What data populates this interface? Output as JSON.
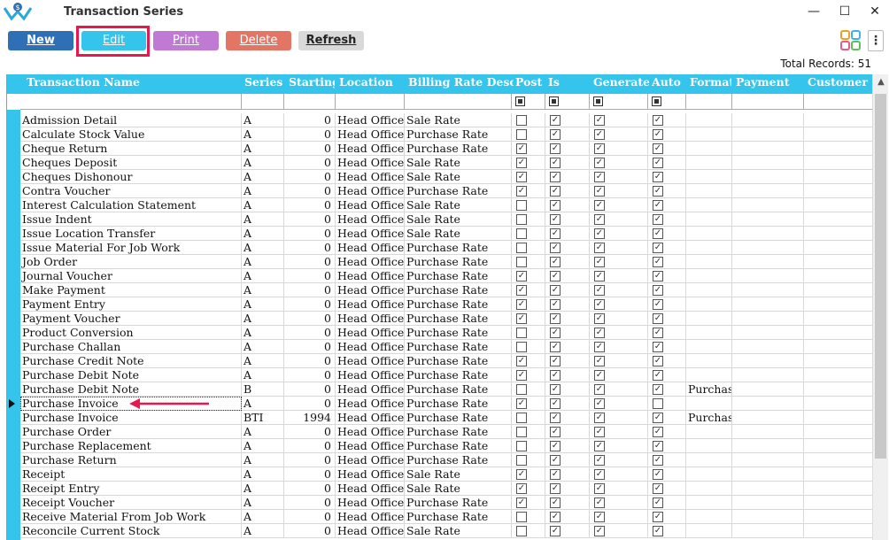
{
  "window": {
    "title": "Transaction Series",
    "minimize": "—",
    "maximize": "☐",
    "close": "✕"
  },
  "toolbar": {
    "new": "New",
    "edit": "Edit",
    "print": "Print",
    "delete": "Delete",
    "refresh": "Refresh",
    "menu": "⋮"
  },
  "colors": {
    "accent": "#34c4ec",
    "highlight": "#e8174f"
  },
  "total_records": "Total Records: 51",
  "columns": [
    "Transaction Name",
    "Series",
    "Starting",
    "Location",
    "Billing Rate Desc.",
    "Post",
    "Is",
    "Generate",
    "Auto",
    "Format",
    "Payment",
    "Customer"
  ],
  "rows": [
    {
      "name": "Admission Detail",
      "series": "A",
      "start": "0",
      "loc": "Head Office",
      "rate": "Sale Rate",
      "post": false,
      "is": true,
      "gen": true,
      "auto": true,
      "format": ""
    },
    {
      "name": "Calculate Stock Value",
      "series": "A",
      "start": "0",
      "loc": "Head Office",
      "rate": "Purchase Rate",
      "post": false,
      "is": true,
      "gen": true,
      "auto": true,
      "format": ""
    },
    {
      "name": "Cheque Return",
      "series": "A",
      "start": "0",
      "loc": "Head Office",
      "rate": "Purchase Rate",
      "post": true,
      "is": true,
      "gen": true,
      "auto": true,
      "format": ""
    },
    {
      "name": "Cheques Deposit",
      "series": "A",
      "start": "0",
      "loc": "Head Office",
      "rate": "Sale Rate",
      "post": true,
      "is": true,
      "gen": true,
      "auto": true,
      "format": ""
    },
    {
      "name": "Cheques Dishonour",
      "series": "A",
      "start": "0",
      "loc": "Head Office",
      "rate": "Sale Rate",
      "post": true,
      "is": true,
      "gen": true,
      "auto": true,
      "format": ""
    },
    {
      "name": "Contra Voucher",
      "series": "A",
      "start": "0",
      "loc": "Head Office",
      "rate": "Purchase Rate",
      "post": true,
      "is": true,
      "gen": true,
      "auto": true,
      "format": ""
    },
    {
      "name": "Interest Calculation Statement",
      "series": "A",
      "start": "0",
      "loc": "Head Office",
      "rate": "Sale Rate",
      "post": false,
      "is": true,
      "gen": true,
      "auto": true,
      "format": ""
    },
    {
      "name": "Issue Indent",
      "series": "A",
      "start": "0",
      "loc": "Head Office",
      "rate": "Sale Rate",
      "post": false,
      "is": true,
      "gen": true,
      "auto": true,
      "format": ""
    },
    {
      "name": "Issue Location Transfer",
      "series": "A",
      "start": "0",
      "loc": "Head Office",
      "rate": "Sale Rate",
      "post": false,
      "is": true,
      "gen": true,
      "auto": true,
      "format": ""
    },
    {
      "name": "Issue Material For Job Work",
      "series": "A",
      "start": "0",
      "loc": "Head Office",
      "rate": "Purchase Rate",
      "post": false,
      "is": true,
      "gen": true,
      "auto": true,
      "format": ""
    },
    {
      "name": "Job Order",
      "series": "A",
      "start": "0",
      "loc": "Head Office",
      "rate": "Purchase Rate",
      "post": false,
      "is": true,
      "gen": true,
      "auto": true,
      "format": ""
    },
    {
      "name": "Journal Voucher",
      "series": "A",
      "start": "0",
      "loc": "Head Office",
      "rate": "Purchase Rate",
      "post": true,
      "is": true,
      "gen": true,
      "auto": true,
      "format": ""
    },
    {
      "name": "Make Payment",
      "series": "A",
      "start": "0",
      "loc": "Head Office",
      "rate": "Purchase Rate",
      "post": true,
      "is": true,
      "gen": true,
      "auto": true,
      "format": ""
    },
    {
      "name": "Payment Entry",
      "series": "A",
      "start": "0",
      "loc": "Head Office",
      "rate": "Purchase Rate",
      "post": true,
      "is": true,
      "gen": true,
      "auto": true,
      "format": ""
    },
    {
      "name": "Payment Voucher",
      "series": "A",
      "start": "0",
      "loc": "Head Office",
      "rate": "Purchase Rate",
      "post": true,
      "is": true,
      "gen": true,
      "auto": true,
      "format": ""
    },
    {
      "name": "Product Conversion",
      "series": "A",
      "start": "0",
      "loc": "Head Office",
      "rate": "Purchase Rate",
      "post": false,
      "is": true,
      "gen": true,
      "auto": true,
      "format": ""
    },
    {
      "name": "Purchase Challan",
      "series": "A",
      "start": "0",
      "loc": "Head Office",
      "rate": "Purchase Rate",
      "post": false,
      "is": true,
      "gen": true,
      "auto": true,
      "format": ""
    },
    {
      "name": "Purchase Credit Note",
      "series": "A",
      "start": "0",
      "loc": "Head Office",
      "rate": "Purchase Rate",
      "post": true,
      "is": true,
      "gen": true,
      "auto": true,
      "format": ""
    },
    {
      "name": "Purchase Debit Note",
      "series": "A",
      "start": "0",
      "loc": "Head Office",
      "rate": "Purchase Rate",
      "post": true,
      "is": true,
      "gen": true,
      "auto": true,
      "format": ""
    },
    {
      "name": "Purchase Debit Note",
      "series": "B",
      "start": "0",
      "loc": "Head Office",
      "rate": "Purchase Rate",
      "post": false,
      "is": true,
      "gen": true,
      "auto": true,
      "format": "Purchas"
    },
    {
      "name": "Purchase Invoice",
      "series": "A",
      "start": "0",
      "loc": "Head Office",
      "rate": "Purchase Rate",
      "post": true,
      "is": true,
      "gen": true,
      "auto": false,
      "format": "",
      "current": true
    },
    {
      "name": "Purchase Invoice",
      "series": "BTI",
      "start": "1994",
      "loc": "Head Office",
      "rate": "Purchase Rate",
      "post": false,
      "is": true,
      "gen": true,
      "auto": true,
      "format": "Purchas"
    },
    {
      "name": "Purchase Order",
      "series": "A",
      "start": "0",
      "loc": "Head Office",
      "rate": "Purchase Rate",
      "post": false,
      "is": true,
      "gen": true,
      "auto": true,
      "format": ""
    },
    {
      "name": "Purchase Replacement",
      "series": "A",
      "start": "0",
      "loc": "Head Office",
      "rate": "Purchase Rate",
      "post": false,
      "is": true,
      "gen": true,
      "auto": true,
      "format": ""
    },
    {
      "name": "Purchase Return",
      "series": "A",
      "start": "0",
      "loc": "Head Office",
      "rate": "Purchase Rate",
      "post": false,
      "is": true,
      "gen": true,
      "auto": true,
      "format": ""
    },
    {
      "name": "Receipt",
      "series": "A",
      "start": "0",
      "loc": "Head Office",
      "rate": "Sale Rate",
      "post": true,
      "is": true,
      "gen": true,
      "auto": true,
      "format": ""
    },
    {
      "name": "Receipt Entry",
      "series": "A",
      "start": "0",
      "loc": "Head Office",
      "rate": "Sale Rate",
      "post": true,
      "is": true,
      "gen": true,
      "auto": true,
      "format": ""
    },
    {
      "name": "Receipt Voucher",
      "series": "A",
      "start": "0",
      "loc": "Head Office",
      "rate": "Purchase Rate",
      "post": true,
      "is": true,
      "gen": true,
      "auto": true,
      "format": ""
    },
    {
      "name": "Receive Material From Job Work",
      "series": "A",
      "start": "0",
      "loc": "Head Office",
      "rate": "Purchase Rate",
      "post": false,
      "is": true,
      "gen": true,
      "auto": true,
      "format": ""
    },
    {
      "name": "Reconcile Current Stock",
      "series": "A",
      "start": "0",
      "loc": "Head Office",
      "rate": "Sale Rate",
      "post": false,
      "is": true,
      "gen": true,
      "auto": true,
      "format": ""
    }
  ]
}
